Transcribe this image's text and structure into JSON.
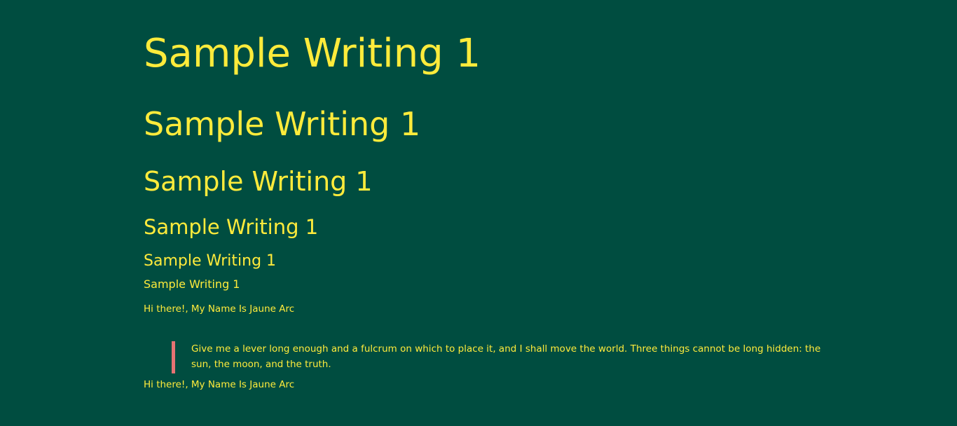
{
  "headings": {
    "h1": "Sample Writing 1",
    "h2": "Sample Writing 1",
    "h3": "Sample Writing 1",
    "h4": "Sample Writing 1",
    "h5": "Sample Writing 1",
    "h6": "Sample Writing 1"
  },
  "paragraphs": {
    "intro": "Hi there!, My Name Is Jaune Arc",
    "outro": "Hi there!, My Name Is Jaune Arc"
  },
  "blockquote": {
    "text": "Give me a lever long enough and a fulcrum on which to place it, and I shall move the world. Three things cannot be long hidden: the sun, the moon, and the truth."
  },
  "colors": {
    "background": "#004d40",
    "text": "#ffeb3b",
    "quote_border": "#e57373"
  }
}
